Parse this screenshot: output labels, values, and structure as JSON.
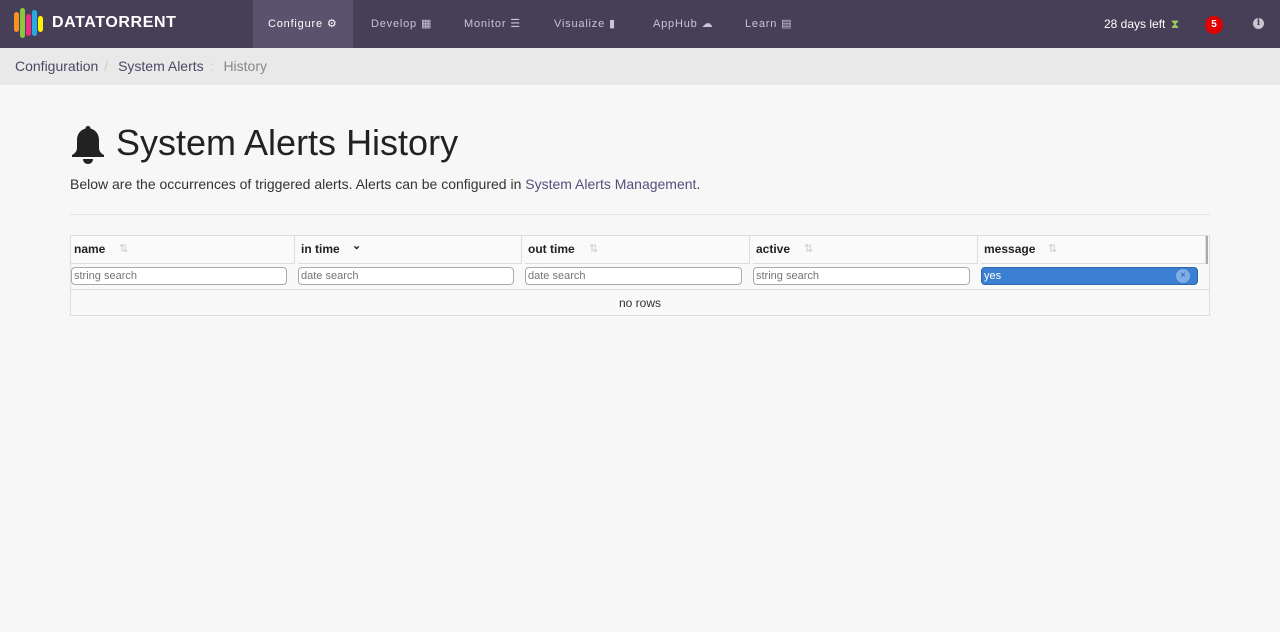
{
  "brand": {
    "name": "DATATORRENT",
    "logo_icon": "datatorrent-logo-icon"
  },
  "nav": {
    "items": [
      {
        "label": "Configure",
        "icon": "gear-icon",
        "glyph": "⚙"
      },
      {
        "label": "Develop",
        "icon": "grid-icon",
        "glyph": "▦"
      },
      {
        "label": "Monitor",
        "icon": "list-icon",
        "glyph": "☰"
      },
      {
        "label": "Visualize",
        "icon": "bar-chart-icon",
        "glyph": "▮"
      },
      {
        "label": "AppHub",
        "icon": "cloud-icon",
        "glyph": "☁"
      },
      {
        "label": "Learn",
        "icon": "book-icon",
        "glyph": "▤"
      }
    ],
    "active": "Configure",
    "trial_text": "28 days left",
    "notification_count": "5",
    "info_glyph": "i",
    "hourglass_glyph": "⧗"
  },
  "breadcrumb": [
    "Configuration",
    "System Alerts",
    "History"
  ],
  "page": {
    "title": "System Alerts History",
    "description_prefix": "Below are the occurrences of triggered alerts. Alerts can be configured in ",
    "description_link": "System Alerts Management",
    "description_suffix": "."
  },
  "table": {
    "columns": [
      {
        "label": "name",
        "filter_placeholder": "string search",
        "filter_value": ""
      },
      {
        "label": "in time",
        "filter_placeholder": "date search",
        "filter_value": ""
      },
      {
        "label": "out time",
        "filter_placeholder": "date search",
        "filter_value": ""
      },
      {
        "label": "active",
        "filter_placeholder": "string search",
        "filter_value": ""
      },
      {
        "label": "message",
        "filter_placeholder": "string search",
        "filter_value": "yes"
      }
    ],
    "sort_glyph": "⇅",
    "sorted_desc_glyph": "⌄",
    "clear_glyph": "×",
    "empty_text": "no rows"
  },
  "colors": {
    "navbar": "#463f57",
    "navbar_active": "#5b536d",
    "link": "#4e4764",
    "filter_active": "#3b7fd0",
    "badge": "#e00000"
  }
}
